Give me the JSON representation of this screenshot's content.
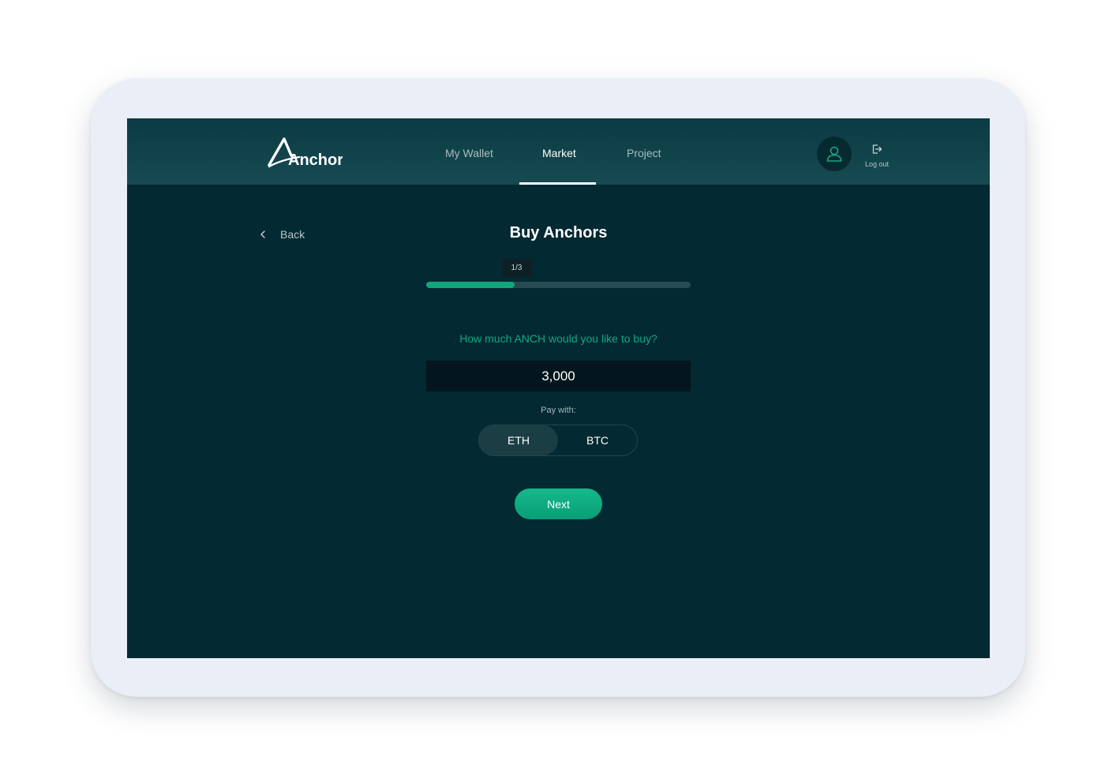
{
  "header": {
    "logo_text": "Anchor",
    "nav": [
      {
        "label": "My Wallet",
        "active": false
      },
      {
        "label": "Market",
        "active": true
      },
      {
        "label": "Project",
        "active": false
      }
    ],
    "logout_label": "Log out"
  },
  "page": {
    "back_label": "Back",
    "title": "Buy Anchors",
    "step_label": "1/3",
    "progress_fraction": 0.3333,
    "question": "How much ANCH would you like to buy?",
    "amount_value": "3,000",
    "pay_with_label": "Pay with:",
    "pay_options": [
      {
        "label": "ETH",
        "selected": true
      },
      {
        "label": "BTC",
        "selected": false
      }
    ],
    "next_label": "Next"
  },
  "colors": {
    "accent": "#10a77d",
    "background": "#032932",
    "header": "#174a52"
  },
  "icons": [
    "user-icon",
    "logout-icon",
    "chevron-left-icon"
  ]
}
